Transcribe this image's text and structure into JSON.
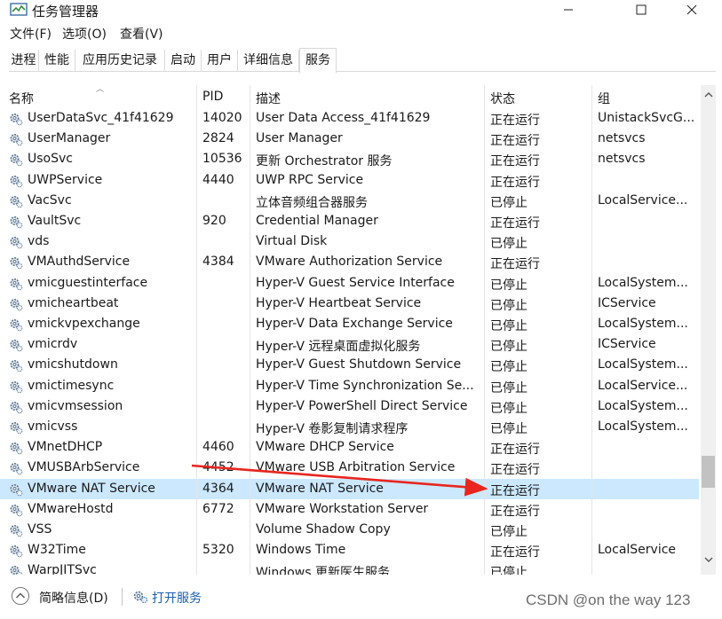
{
  "window": {
    "title": "任务管理器"
  },
  "menu": [
    "文件(F)",
    "选项(O)",
    "查看(V)"
  ],
  "tabs": [
    "进程",
    "性能",
    "应用历史记录",
    "启动",
    "用户",
    "详细信息",
    "服务"
  ],
  "active_tab": "服务",
  "columns": {
    "name": "名称",
    "pid": "PID",
    "desc": "描述",
    "status": "状态",
    "group": "组"
  },
  "rows": [
    {
      "name": "UserDataSvc_41f41629",
      "pid": "14020",
      "desc": "User Data Access_41f41629",
      "status": "正在运行",
      "group": "UnistackSvcG..."
    },
    {
      "name": "UserManager",
      "pid": "2824",
      "desc": "User Manager",
      "status": "正在运行",
      "group": "netsvcs"
    },
    {
      "name": "UsoSvc",
      "pid": "10536",
      "desc": "更新 Orchestrator 服务",
      "status": "正在运行",
      "group": "netsvcs"
    },
    {
      "name": "UWPService",
      "pid": "4440",
      "desc": "UWP RPC Service",
      "status": "正在运行",
      "group": ""
    },
    {
      "name": "VacSvc",
      "pid": "",
      "desc": "立体音频组合器服务",
      "status": "已停止",
      "group": "LocalService..."
    },
    {
      "name": "VaultSvc",
      "pid": "920",
      "desc": "Credential Manager",
      "status": "正在运行",
      "group": ""
    },
    {
      "name": "vds",
      "pid": "",
      "desc": "Virtual Disk",
      "status": "已停止",
      "group": ""
    },
    {
      "name": "VMAuthdService",
      "pid": "4384",
      "desc": "VMware Authorization Service",
      "status": "正在运行",
      "group": ""
    },
    {
      "name": "vmicguestinterface",
      "pid": "",
      "desc": "Hyper-V Guest Service Interface",
      "status": "已停止",
      "group": "LocalSystem..."
    },
    {
      "name": "vmicheartbeat",
      "pid": "",
      "desc": "Hyper-V Heartbeat Service",
      "status": "已停止",
      "group": "ICService"
    },
    {
      "name": "vmickvpexchange",
      "pid": "",
      "desc": "Hyper-V Data Exchange Service",
      "status": "已停止",
      "group": "LocalSystem..."
    },
    {
      "name": "vmicrdv",
      "pid": "",
      "desc": "Hyper-V 远程桌面虚拟化服务",
      "status": "已停止",
      "group": "ICService"
    },
    {
      "name": "vmicshutdown",
      "pid": "",
      "desc": "Hyper-V Guest Shutdown Service",
      "status": "已停止",
      "group": "LocalSystem..."
    },
    {
      "name": "vmictimesync",
      "pid": "",
      "desc": "Hyper-V Time Synchronization Se...",
      "status": "已停止",
      "group": "LocalService..."
    },
    {
      "name": "vmicvmsession",
      "pid": "",
      "desc": "Hyper-V PowerShell Direct Service",
      "status": "已停止",
      "group": "LocalSystem..."
    },
    {
      "name": "vmicvss",
      "pid": "",
      "desc": "Hyper-V 卷影复制请求程序",
      "status": "已停止",
      "group": "LocalSystem..."
    },
    {
      "name": "VMnetDHCP",
      "pid": "4460",
      "desc": "VMware DHCP Service",
      "status": "正在运行",
      "group": ""
    },
    {
      "name": "VMUSBArbService",
      "pid": "4452",
      "desc": "VMware USB Arbitration Service",
      "status": "正在运行",
      "group": ""
    },
    {
      "name": "VMware NAT Service",
      "pid": "4364",
      "desc": "VMware NAT Service",
      "status": "正在运行",
      "group": ""
    },
    {
      "name": "VMwareHostd",
      "pid": "6772",
      "desc": "VMware Workstation Server",
      "status": "正在运行",
      "group": ""
    },
    {
      "name": "VSS",
      "pid": "",
      "desc": "Volume Shadow Copy",
      "status": "已停止",
      "group": ""
    },
    {
      "name": "W32Time",
      "pid": "5320",
      "desc": "Windows Time",
      "status": "正在运行",
      "group": "LocalService"
    },
    {
      "name": "WarpJITSvc",
      "pid": "",
      "desc": "Windows 更新医生服务",
      "status": "已停止",
      "group": ""
    }
  ],
  "selected_row": "VMware NAT Service",
  "footer": {
    "details": "简略信息(D)",
    "open_services": "打开服务"
  },
  "watermark": "CSDN @on the way 123",
  "colors": {
    "selection": "#cce8ff",
    "annotation_arrow": "#e8261f",
    "link": "#1a5fb4"
  }
}
